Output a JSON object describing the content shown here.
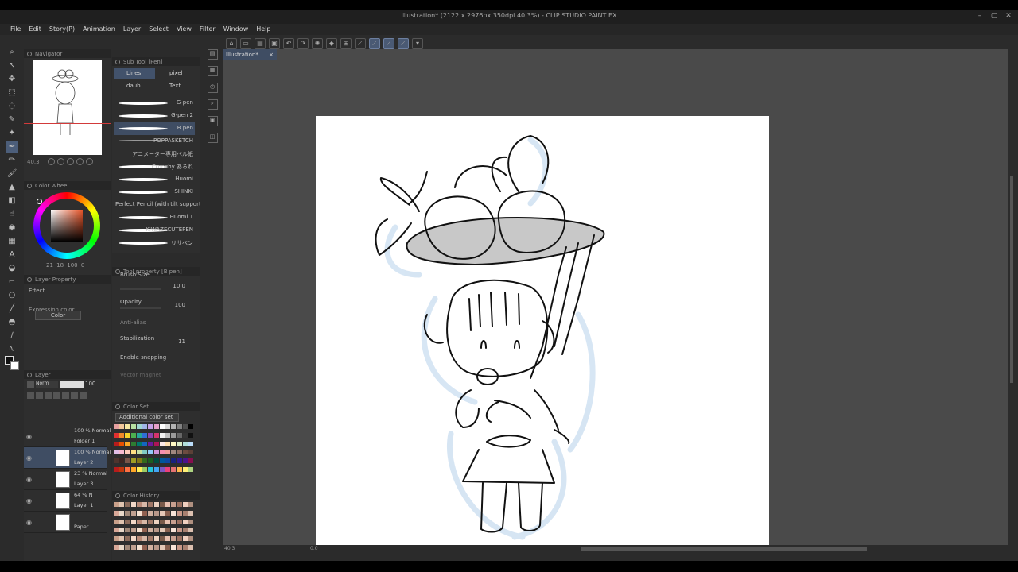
{
  "window": {
    "title": "Illustration* (2122 x 2976px 350dpi 40.3%) - CLIP STUDIO PAINT EX"
  },
  "menu": [
    "File",
    "Edit",
    "Story(P)",
    "Animation",
    "Layer",
    "Select",
    "View",
    "Filter",
    "Window",
    "Help"
  ],
  "navigator": {
    "title": "Navigator",
    "zoom": "40.3",
    "angle": "0.0"
  },
  "color_wheel": {
    "title": "Color Wheel",
    "values": "21 18 100 0"
  },
  "layer_property": {
    "title": "Layer Property",
    "effect": "Effect",
    "expression_color_label": "Expression color",
    "expression_color_value": "Color"
  },
  "layers": {
    "title": "Layer",
    "blend": "Norm",
    "opacity": "100",
    "items": [
      {
        "mode": "100 % Normal",
        "name": "Folder 1"
      },
      {
        "mode": "100 % Normal",
        "name": "Layer 2"
      },
      {
        "mode": "23 % Normal",
        "name": "Layer 3"
      },
      {
        "mode": "64 % N",
        "name": "Layer 1"
      },
      {
        "mode": "",
        "name": "Paper"
      }
    ]
  },
  "subtool": {
    "title": "Sub Tool [Pen]",
    "tabs": [
      "Lines",
      "pixel",
      "daub",
      "Text"
    ],
    "brushes": [
      "G-pen",
      "G-pen 2",
      "B pen",
      "POPPASKETCH",
      "アニメーター専用ペル紙",
      "Crunchy あるれ",
      "Huomi",
      "SHINKI",
      "Perfect Pencil (with tilt support)",
      "Huomi 1",
      "KIWAZECUTEPEN",
      "リサペン"
    ]
  },
  "tool_property": {
    "title": "Tool property [B pen]",
    "brush_size_label": "Brush Size",
    "brush_size": "10.0",
    "opacity_label": "Opacity",
    "opacity": "100",
    "anti_alias_label": "Anti-alias",
    "stabilization_label": "Stabilization",
    "stabilization": "11",
    "snapping_label": "Enable snapping",
    "vector_label": "Vector magnet"
  },
  "color_set": {
    "title": "Color Set",
    "selected": "Additional color set"
  },
  "color_history": {
    "title": "Color History"
  },
  "doc_tab": {
    "label": "Illustration*",
    "close": "×"
  },
  "status": {
    "zoom": "40.3",
    "angle": "0.0"
  },
  "colors": {
    "accent": "#4a5a74",
    "selection": "#3f4d63",
    "paper": "#ffffff",
    "background": "#4a4a4a"
  },
  "palette": [
    "#e6a0a0",
    "#f2c79a",
    "#f5e7a1",
    "#b7e0a0",
    "#9fd6d0",
    "#a0b4e6",
    "#c7a0e6",
    "#e6a0c8",
    "#ffffff",
    "#d9d9d9",
    "#b3b3b3",
    "#808080",
    "#4d4d4d",
    "#000000",
    "#e03030",
    "#f08a2a",
    "#f5d32a",
    "#4caf50",
    "#26a69a",
    "#2f6fd6",
    "#8e44ad",
    "#d6336c",
    "#f2f2f2",
    "#c0c0c0",
    "#999999",
    "#666666",
    "#333333",
    "#111111",
    "#b71c1c",
    "#e65100",
    "#f9a825",
    "#2e7d32",
    "#00796b",
    "#1565c0",
    "#6a1b9a",
    "#ad1457",
    "#fbe9e7",
    "#ffe0b2",
    "#fff9c4",
    "#dcedc8",
    "#b2dfdb",
    "#bbdefb",
    "#e1bee7",
    "#f8bbd0",
    "#ffccbc",
    "#ffe082",
    "#c5e1a5",
    "#80cbc4",
    "#90caf9",
    "#ce93d8",
    "#f48fb1",
    "#ef9a9a",
    "#a1887f",
    "#8d6e63",
    "#6d4c41",
    "#5d4037",
    "#4e342e",
    "#3e2723",
    "#795548",
    "#9e9d24",
    "#827717",
    "#33691e",
    "#1b5e20",
    "#004d40",
    "#01579b",
    "#0d47a1",
    "#1a237e",
    "#311b92",
    "#4a148c",
    "#880e4f",
    "#b71c1c",
    "#bf360c",
    "#ff7043",
    "#ffa726",
    "#ffee58",
    "#9ccc65",
    "#26c6da",
    "#42a5f5",
    "#7e57c2",
    "#ec407a",
    "#e57373",
    "#ffb74d",
    "#fff176",
    "#aed581"
  ],
  "history_colors": [
    "#c9a08a",
    "#e0c4b0",
    "#8a6a5a",
    "#f2d8c8",
    "#b88a78",
    "#d7b8a8",
    "#a07868",
    "#ecd2c2",
    "#7a5a4a",
    "#e8c0b0",
    "#c8a090",
    "#9a7060",
    "#f0d0c0",
    "#b09080",
    "#d8a898",
    "#e8d8c8",
    "#a08878",
    "#c0a090",
    "#f4e0d0",
    "#906050",
    "#d0b0a0",
    "#b8988a",
    "#e4c8b8",
    "#886050",
    "#f8e4d8",
    "#c89888",
    "#a88070",
    "#dcc0b0"
  ]
}
